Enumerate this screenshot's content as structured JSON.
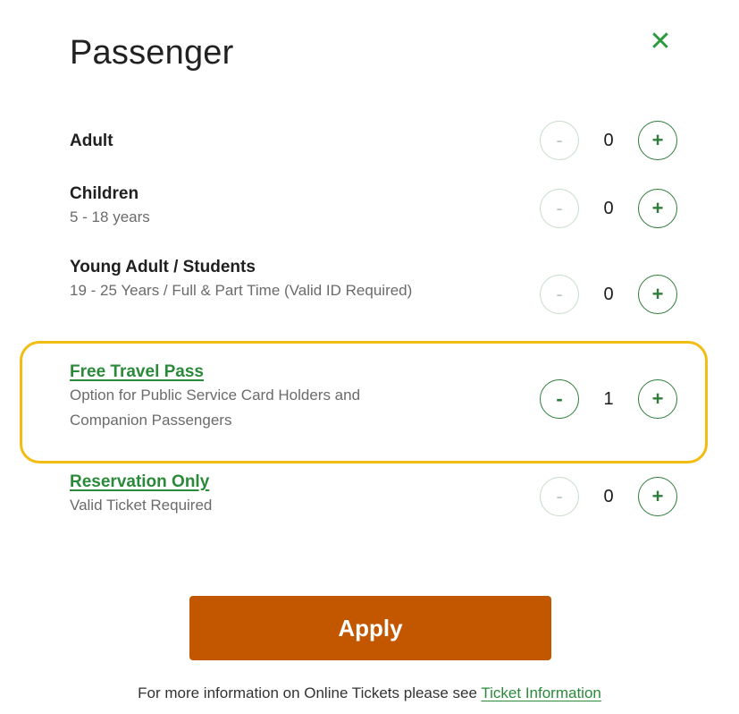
{
  "dialog": {
    "title": "Passenger",
    "close_icon": "close-x-icon"
  },
  "passengers": [
    {
      "label": "Adult",
      "sub": "",
      "count": "0",
      "link": false,
      "minus": "-",
      "plus": "+",
      "minus_enabled": false
    },
    {
      "label": "Children",
      "sub": "5 - 18 years",
      "count": "0",
      "link": false,
      "minus": "-",
      "plus": "+",
      "minus_enabled": false
    },
    {
      "label": "Young Adult / Students",
      "sub": "19 - 25 Years / Full & Part Time (Valid ID Required)",
      "count": "0",
      "link": false,
      "minus": "-",
      "plus": "+",
      "minus_enabled": false
    },
    {
      "label": "Free Travel Pass",
      "sub": "Option for Public Service Card Holders and Companion Passengers",
      "count": "1",
      "link": true,
      "minus": "-",
      "plus": "+",
      "minus_enabled": true
    },
    {
      "label": "Reservation Only",
      "sub": "Valid Ticket Required",
      "count": "0",
      "link": true,
      "minus": "-",
      "plus": "+",
      "minus_enabled": false
    }
  ],
  "apply_label": "Apply",
  "footer": {
    "text": "For more information on Online Tickets please see ",
    "link": "Ticket Information"
  },
  "colors": {
    "accent_green": "#2a8a3a",
    "apply_orange": "#c25700",
    "highlight_yellow": "#f2bd12"
  }
}
